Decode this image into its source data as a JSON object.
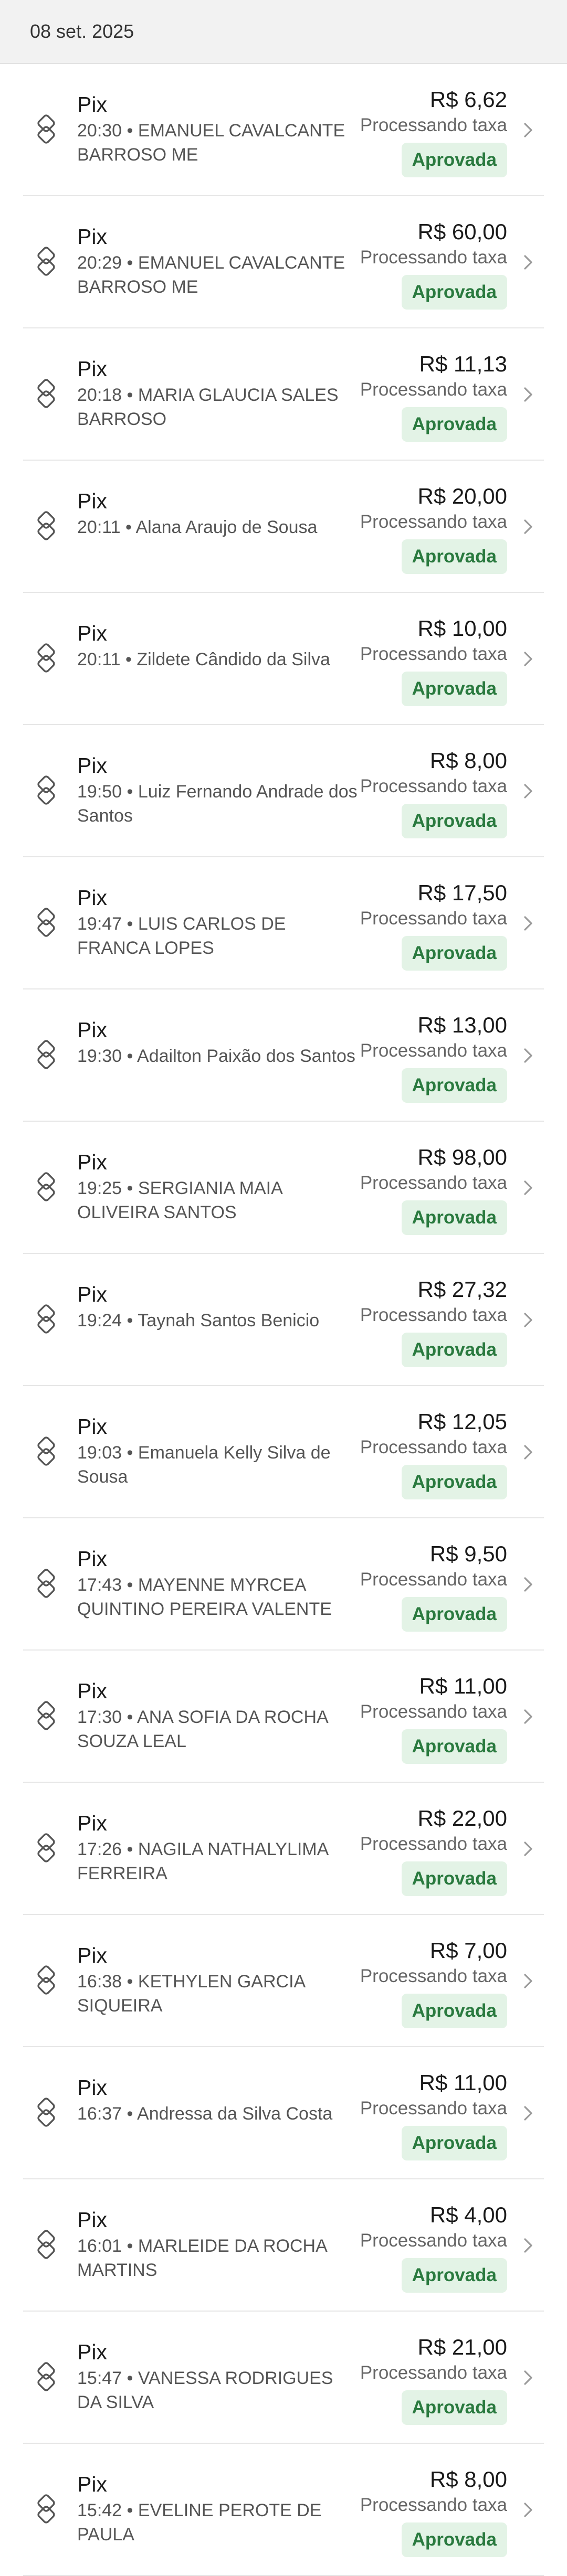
{
  "header": {
    "date": "08 set. 2025"
  },
  "transactions": [
    {
      "method": "Pix",
      "time": "20:30",
      "name": "EMANUEL CAVALCANTE BARROSO ME",
      "amount": "R$ 6,62",
      "fee": "Processando taxa",
      "status": "Aprovada"
    },
    {
      "method": "Pix",
      "time": "20:29",
      "name": "EMANUEL CAVALCANTE BARROSO ME",
      "amount": "R$ 60,00",
      "fee": "Processando taxa",
      "status": "Aprovada"
    },
    {
      "method": "Pix",
      "time": "20:18",
      "name": "MARIA GLAUCIA SALES BARROSO",
      "amount": "R$ 11,13",
      "fee": "Processando taxa",
      "status": "Aprovada"
    },
    {
      "method": "Pix",
      "time": "20:11",
      "name": "Alana Araujo de Sousa",
      "amount": "R$ 20,00",
      "fee": "Processando taxa",
      "status": "Aprovada"
    },
    {
      "method": "Pix",
      "time": "20:11",
      "name": "Zildete Cândido da Silva",
      "amount": "R$ 10,00",
      "fee": "Processando taxa",
      "status": "Aprovada"
    },
    {
      "method": "Pix",
      "time": "19:50",
      "name": "Luiz Fernando Andrade dos Santos",
      "amount": "R$ 8,00",
      "fee": "Processando taxa",
      "status": "Aprovada"
    },
    {
      "method": "Pix",
      "time": "19:47",
      "name": "LUIS CARLOS DE FRANCA LOPES",
      "amount": "R$ 17,50",
      "fee": "Processando taxa",
      "status": "Aprovada"
    },
    {
      "method": "Pix",
      "time": "19:30",
      "name": "Adailton Paixão dos Santos",
      "amount": "R$ 13,00",
      "fee": "Processando taxa",
      "status": "Aprovada"
    },
    {
      "method": "Pix",
      "time": "19:25",
      "name": "SERGIANIA MAIA OLIVEIRA SANTOS",
      "amount": "R$ 98,00",
      "fee": "Processando taxa",
      "status": "Aprovada"
    },
    {
      "method": "Pix",
      "time": "19:24",
      "name": "Taynah Santos Benicio",
      "amount": "R$ 27,32",
      "fee": "Processando taxa",
      "status": "Aprovada"
    },
    {
      "method": "Pix",
      "time": "19:03",
      "name": "Emanuela Kelly Silva de Sousa",
      "amount": "R$ 12,05",
      "fee": "Processando taxa",
      "status": "Aprovada"
    },
    {
      "method": "Pix",
      "time": "17:43",
      "name": "MAYENNE MYRCEA QUINTINO PEREIRA VALENTE",
      "amount": "R$ 9,50",
      "fee": "Processando taxa",
      "status": "Aprovada"
    },
    {
      "method": "Pix",
      "time": "17:30",
      "name": "ANA SOFIA DA ROCHA SOUZA LEAL",
      "amount": "R$ 11,00",
      "fee": "Processando taxa",
      "status": "Aprovada"
    },
    {
      "method": "Pix",
      "time": "17:26",
      "name": "NAGILA NATHALYLIMA FERREIRA",
      "amount": "R$ 22,00",
      "fee": "Processando taxa",
      "status": "Aprovada"
    },
    {
      "method": "Pix",
      "time": "16:38",
      "name": "KETHYLEN GARCIA SIQUEIRA",
      "amount": "R$ 7,00",
      "fee": "Processando taxa",
      "status": "Aprovada"
    },
    {
      "method": "Pix",
      "time": "16:37",
      "name": "Andressa da Silva Costa",
      "amount": "R$ 11,00",
      "fee": "Processando taxa",
      "status": "Aprovada"
    },
    {
      "method": "Pix",
      "time": "16:01",
      "name": "MARLEIDE DA ROCHA MARTINS",
      "amount": "R$ 4,00",
      "fee": "Processando taxa",
      "status": "Aprovada"
    },
    {
      "method": "Pix",
      "time": "15:47",
      "name": "VANESSA RODRIGUES DA SILVA",
      "amount": "R$ 21,00",
      "fee": "Processando taxa",
      "status": "Aprovada"
    },
    {
      "method": "Pix",
      "time": "15:42",
      "name": "EVELINE PEROTE DE PAULA",
      "amount": "R$ 8,00",
      "fee": "Processando taxa",
      "status": "Aprovada"
    }
  ],
  "icons": {
    "payment_method": "pix-icon",
    "row_action": "chevron-right-icon"
  },
  "colors": {
    "status_badge_bg": "#e3f3e6",
    "status_badge_text": "#2a7a3f",
    "header_bg": "#f2f2f2"
  }
}
